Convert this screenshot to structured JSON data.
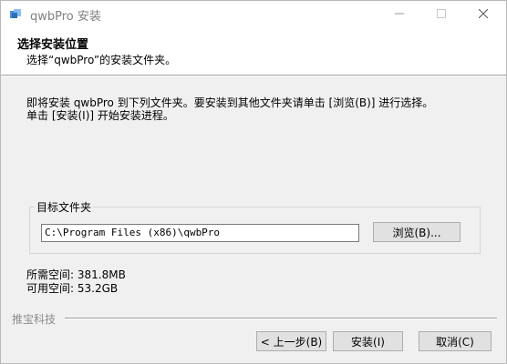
{
  "window": {
    "title": "qwbPro 安装",
    "controls": [
      "minimize-icon",
      "maximize-icon",
      "close-icon"
    ]
  },
  "header": {
    "title": "选择安装位置",
    "subtitle": "选择“qwbPro”的安装文件夹。"
  },
  "description": {
    "line1": "即将安装 qwbPro 到下列文件夹。要安装到其他文件夹请单击 [浏览(B)] 进行选择。",
    "line2": "单击 [安装(I)] 开始安装进程。"
  },
  "destination": {
    "group_label": "目标文件夹",
    "path": "C:\\Program Files (x86)\\qwbPro",
    "browse_label": "浏览(B)..."
  },
  "space": {
    "required": "所需空间: 381.8MB",
    "available": "可用空间: 53.2GB"
  },
  "footer": {
    "brand": "推宝科技",
    "back_label": "< 上一步(B)",
    "install_label": "安装(I)",
    "cancel_label": "取消(C)"
  },
  "colors": {
    "window_bg": "#f0f0f0",
    "header_bg": "#ffffff",
    "button_bg": "#e1e1e1",
    "brand_text": "#8c8c8c"
  }
}
